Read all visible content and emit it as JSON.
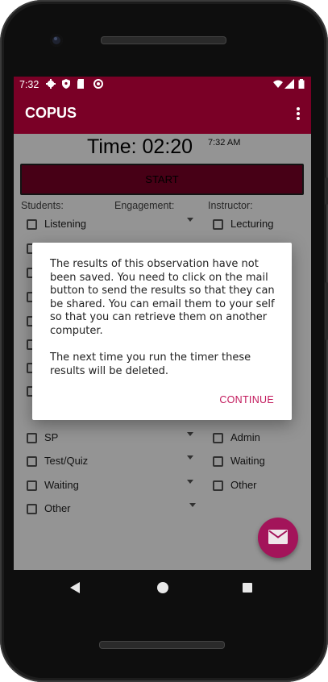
{
  "status_bar": {
    "time": "7:32",
    "icons": [
      "gear-icon",
      "shield-icon",
      "sd-card-icon",
      "sync-icon",
      "wifi-icon",
      "signal-icon",
      "battery-icon"
    ]
  },
  "app_bar": {
    "title": "COPUS",
    "menu_icon": "overflow-menu-icon"
  },
  "timer": {
    "display": "Time: 02:20",
    "clock": "7:32 AM"
  },
  "start_button": {
    "label": "START"
  },
  "columns": {
    "students": "Students:",
    "engagement": "Engagement:",
    "instructor": "Instructor:"
  },
  "students": [
    {
      "label": "Listening"
    },
    {
      "label": ""
    },
    {
      "label": ""
    },
    {
      "label": ""
    },
    {
      "label": ""
    },
    {
      "label": ""
    },
    {
      "label": ""
    },
    {
      "label": ""
    },
    {
      "label": "SP"
    },
    {
      "label": "Test/Quiz"
    },
    {
      "label": "Waiting"
    },
    {
      "label": "Other"
    }
  ],
  "instructor": [
    {
      "label": "Lecturing"
    },
    {
      "label": ""
    },
    {
      "label": "Admin"
    },
    {
      "label": "Waiting"
    },
    {
      "label": "Other"
    }
  ],
  "dialog": {
    "message_1": "The results of this observation have not been saved. You need to click on the mail button to send the results so that they can be shared. You can email them to your self so that you can retrieve them on another computer.",
    "message_2": "The next time you run the timer these results will be deleted.",
    "continue_label": "CONTINUE"
  },
  "fab": {
    "icon": "mail-icon"
  },
  "nav": {
    "back": "back-icon",
    "home": "home-icon",
    "recents": "recents-icon"
  },
  "colors": {
    "primary": "#7a0026",
    "accent": "#a3145a",
    "dialog_button": "#c2185b"
  }
}
